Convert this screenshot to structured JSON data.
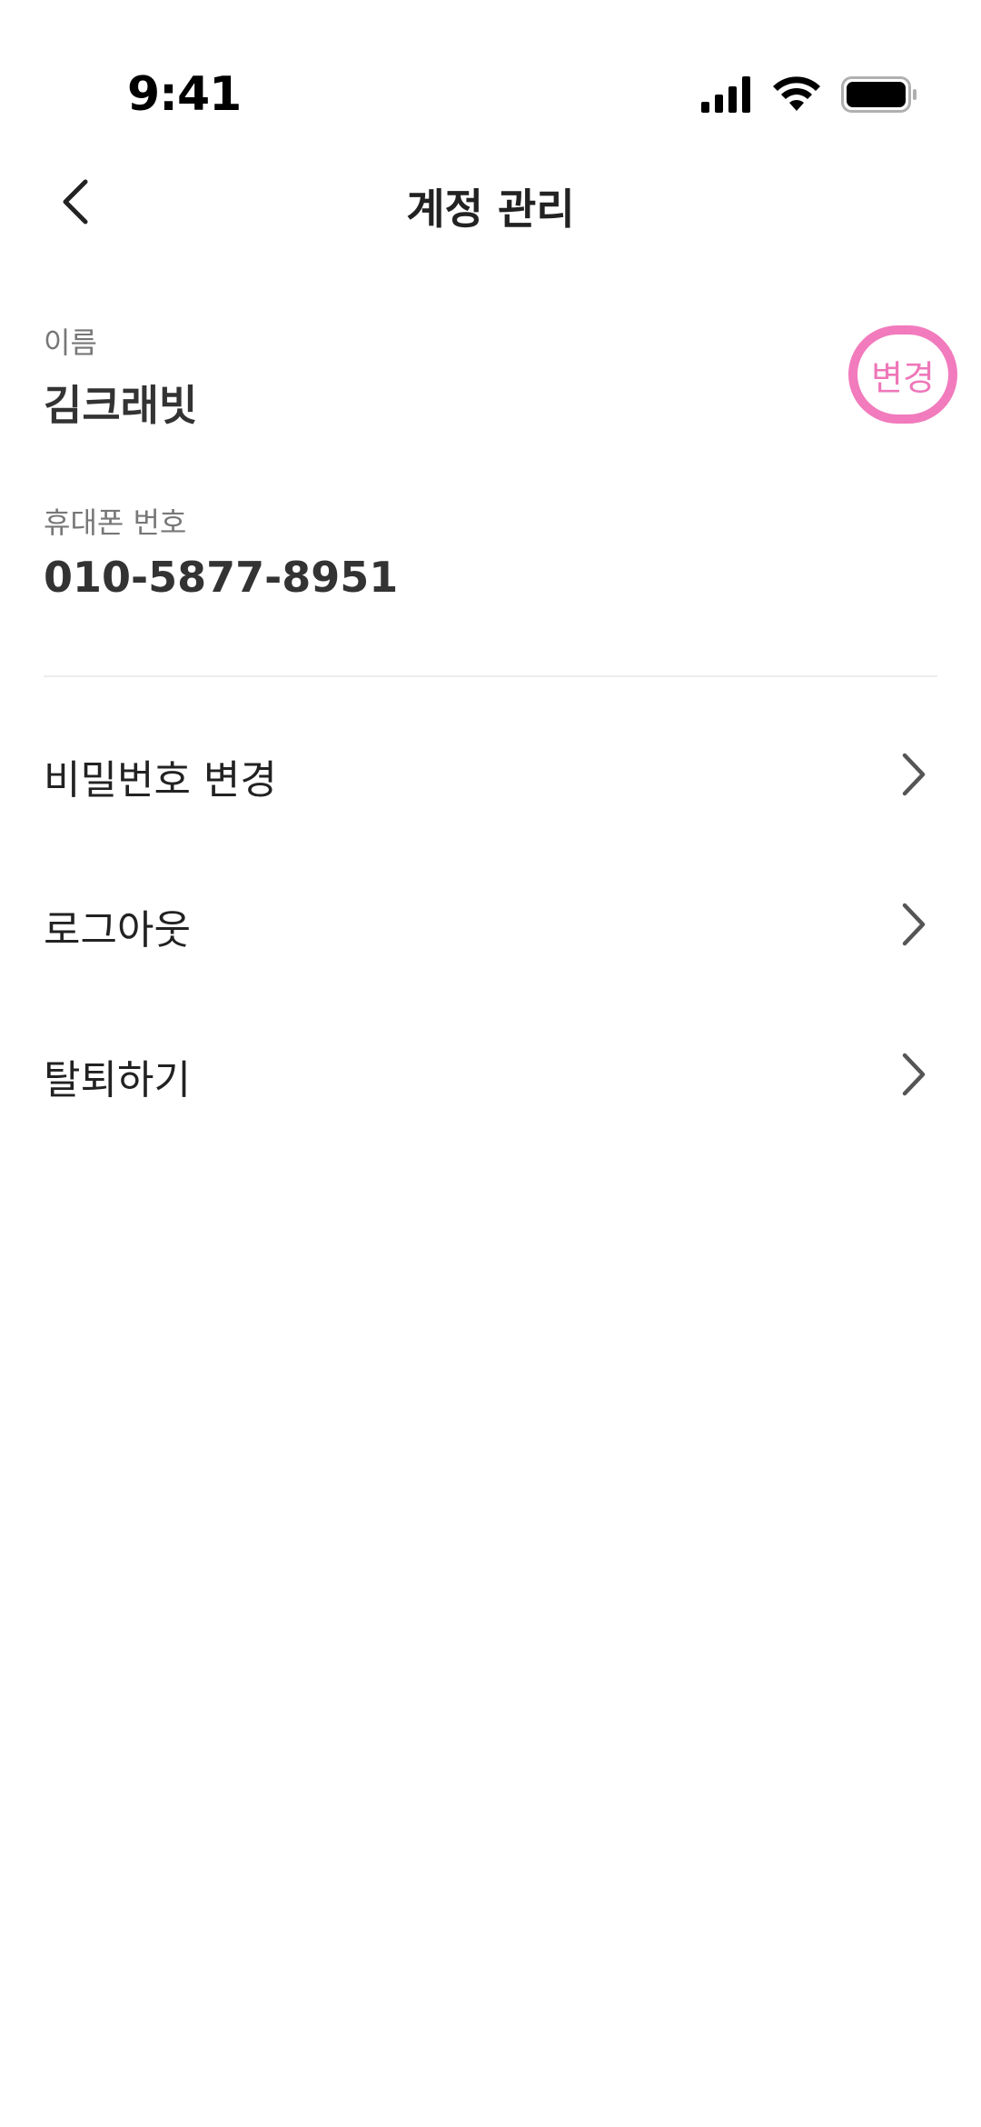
{
  "status_bar": {
    "time": "9:41",
    "icons": [
      "signal-icon",
      "wifi-icon",
      "battery-icon"
    ]
  },
  "header": {
    "title": "계정 관리",
    "back_icon": "back-chevron-icon"
  },
  "profile": {
    "name_label": "이름",
    "name_value": "김크래빗",
    "change_label": "변경",
    "phone_label": "휴대폰 번호",
    "phone_value": "010-5877-8951"
  },
  "menu": {
    "items": [
      {
        "label": "비밀번호 변경",
        "icon": "chevron-right-icon"
      },
      {
        "label": "로그아웃",
        "icon": "chevron-right-icon"
      },
      {
        "label": "탈퇴하기",
        "icon": "chevron-right-icon"
      }
    ]
  },
  "colors": {
    "accent": "#ee77b8",
    "text_primary": "#222222",
    "text_secondary": "#777777",
    "divider": "#eeeeee"
  }
}
